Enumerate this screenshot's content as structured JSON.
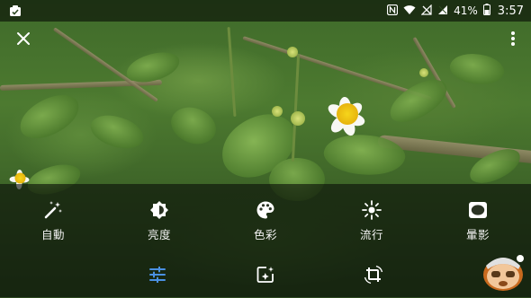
{
  "status_bar": {
    "battery_percent": "41%",
    "time": "3:57",
    "icons": [
      "notification-icon",
      "nfc-icon",
      "wifi-icon",
      "signal-off-icon",
      "signal-icon",
      "battery-icon"
    ]
  },
  "top_bar": {
    "close_icon": "close-icon",
    "overflow_icon": "more-vert-icon"
  },
  "tools": [
    {
      "label": "自動",
      "icon": "auto-fix-icon"
    },
    {
      "label": "亮度",
      "icon": "brightness-icon"
    },
    {
      "label": "色彩",
      "icon": "palette-icon"
    },
    {
      "label": "流行",
      "icon": "pop-icon"
    },
    {
      "label": "暈影",
      "icon": "vignette-icon"
    }
  ],
  "tabs": [
    {
      "name": "adjust",
      "icon": "tune-icon",
      "active": true
    },
    {
      "name": "filters",
      "icon": "photo-filter-icon",
      "active": false
    },
    {
      "name": "crop-rotate",
      "icon": "crop-rotate-icon",
      "active": false
    }
  ],
  "colors": {
    "accent": "#4a90e2",
    "icon": "#ffffff",
    "overlay": "rgba(10,14,8,0.62)"
  }
}
